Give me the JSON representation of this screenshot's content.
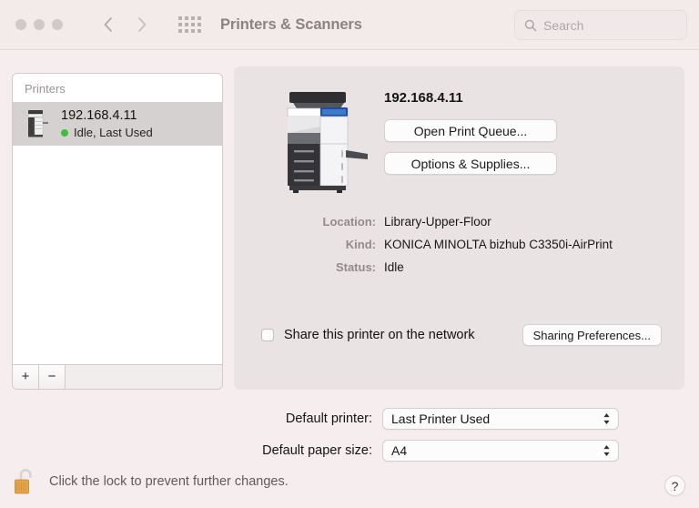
{
  "window": {
    "title": "Printers & Scanners",
    "traffic_lights": [
      "close",
      "minimize",
      "zoom"
    ],
    "back_label": "Back",
    "forward_label": "Forward",
    "show_all_label": "Show All"
  },
  "search": {
    "placeholder": "Search",
    "value": ""
  },
  "sidebar": {
    "header": "Printers",
    "printers": [
      {
        "name": "192.168.4.11",
        "status": "Idle, Last Used",
        "status_color": "#3ac13a",
        "selected": true
      }
    ],
    "add_label": "+",
    "remove_label": "−"
  },
  "detail": {
    "title": "192.168.4.11",
    "buttons": {
      "open_print_queue": "Open Print Queue...",
      "options_supplies": "Options & Supplies..."
    },
    "info": [
      {
        "label": "Location:",
        "value": "Library-Upper-Floor"
      },
      {
        "label": "Kind:",
        "value": "KONICA MINOLTA bizhub C3350i-AirPrint"
      },
      {
        "label": "Status:",
        "value": "Idle"
      }
    ],
    "share": {
      "label": "Share this printer on the network",
      "checked": false,
      "preferences_button": "Sharing Preferences..."
    }
  },
  "defaults": {
    "printer_label": "Default printer:",
    "printer_value": "Last Printer Used",
    "paper_label": "Default paper size:",
    "paper_value": "A4"
  },
  "footer": {
    "lock_text": "Click the lock to prevent further changes.",
    "lock_state": "unlocked",
    "help_label": "?"
  },
  "colors": {
    "background": "#f6eeee",
    "panel": "#e9e4e3",
    "titlebar": "#f3eaea",
    "status_green": "#3ac13a",
    "lock_gold": "#e0a048"
  }
}
